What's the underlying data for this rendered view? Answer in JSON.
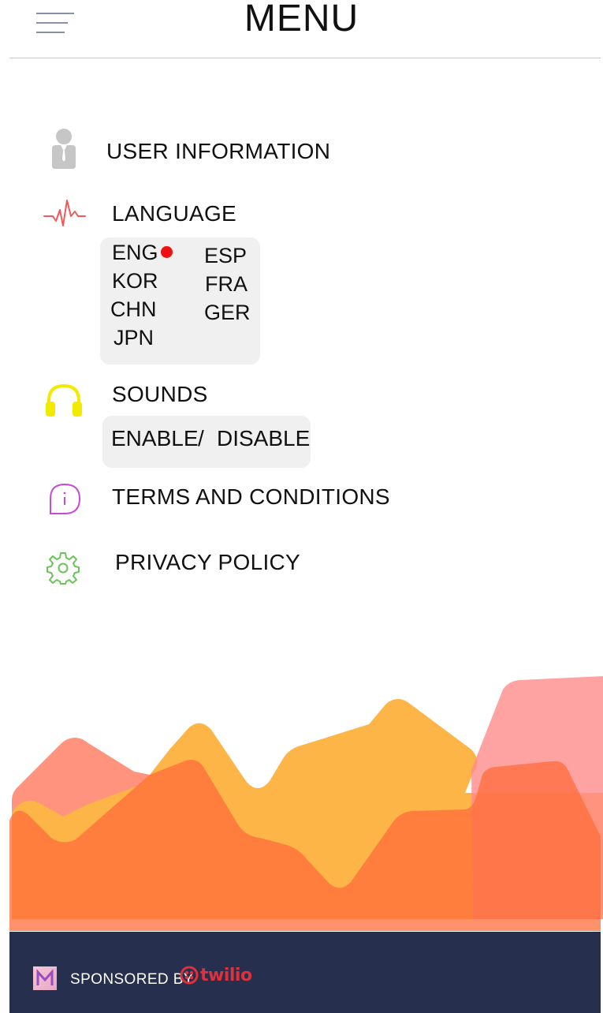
{
  "header": {
    "title": "MENU",
    "menu_icon": "hamburger-icon"
  },
  "menu": {
    "user_information": {
      "label": "USER INFORMATION",
      "icon": "user-icon",
      "icon_color": "#c6c6c6"
    },
    "language": {
      "label": "LANGUAGE",
      "icon": "pulse-icon",
      "icon_color": "#f05a5a"
    },
    "sounds": {
      "label": "SOUNDS",
      "icon": "headphones-icon",
      "icon_color": "#f2ea00"
    },
    "terms": {
      "label": "TERMS AND CONDITIONS",
      "icon": "info-icon",
      "icon_color": "#c84ad8"
    },
    "privacy": {
      "label": "PRIVACY POLICY",
      "icon": "gear-icon",
      "icon_color": "#6cc35a"
    }
  },
  "languages": {
    "options": [
      "ENG",
      "KOR",
      "CHN",
      "JPN",
      "ESP",
      "FRA",
      "GER"
    ],
    "selected": "ENG",
    "selected_dot_color": "#ee1111"
  },
  "sounds_toggle": {
    "enable": "ENABLE",
    "separator": "/",
    "disable": "DISABLE"
  },
  "footer": {
    "sponsored_by": "SPONSORED BY",
    "sponsor_name": "twilio",
    "sponsor_color": "#e0313b",
    "background": "#262f4e",
    "app_logo": "app-logo-icon"
  }
}
